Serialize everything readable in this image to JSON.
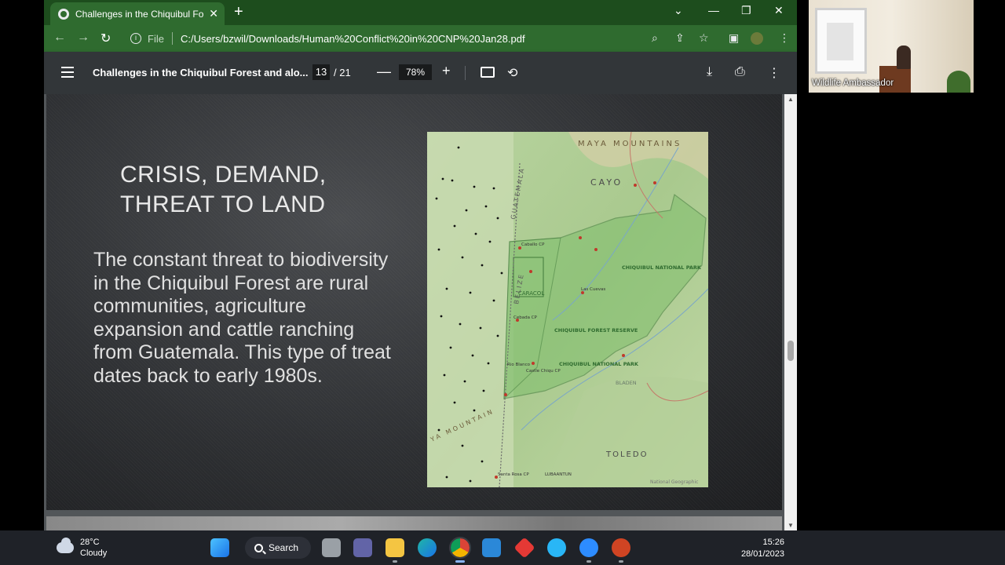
{
  "browser": {
    "tab_title": "Challenges in the Chiquibul Forest",
    "address_scheme": "File",
    "url": "C:/Users/bzwil/Downloads/Human%20Conflict%20in%20CNP%20Jan28.pdf"
  },
  "pdf_toolbar": {
    "title": "Challenges in the Chiquibul Forest and alo...",
    "current_page": "13",
    "total_pages": "/ 21",
    "zoom": "78%"
  },
  "slide": {
    "title": "CRISIS, DEMAND, THREAT TO LAND",
    "body": "The constant threat to biodiversity in the Chiquibul Forest are rural communities, agriculture expansion and cattle ranching from Guatemala. This type of treat dates back to early 1980s."
  },
  "map": {
    "labels": {
      "maya_mountains": "MAYA MOUNTAINS",
      "cayo": "CAYO",
      "guatemala": "GUATEMALA",
      "belize": "BELIZE",
      "caracol": "CARACOL",
      "chiquibul_np": "CHIQUIBUL NATIONAL PARK",
      "chiquibul_fr": "CHIQUIBUL FOREST RESERVE",
      "chiquibul_np2": "CHIQUIBUL NATIONAL PARK",
      "toledo": "TOLEDO",
      "maya_mountains_sw": "YA MOUNTAIN",
      "las_cuevas": "Las Cuevas",
      "caballo_cp": "Caballo CP",
      "cebada_cp": "Cebada CP",
      "rio_blanco": "Rio Blanco",
      "castle_chiqu": "Castle Chiqu CP",
      "santa_rosa": "Santa Rosa CP",
      "lubaantun": "LUBAANTUN",
      "bladen": "BLADEN",
      "credit": "National Geographic"
    }
  },
  "video": {
    "participant_name": "Wildlife Ambassador"
  },
  "taskbar": {
    "temperature": "28°C",
    "weather": "Cloudy",
    "search_label": "Search",
    "time": "15:26",
    "date": "28/01/2023"
  },
  "colors": {
    "tab_bar": "#1d4d1d",
    "address_bar": "#2f6b2f",
    "pdf_toolbar": "#323639",
    "viewer_bg": "#525659",
    "taskbar": "#1f2228"
  }
}
